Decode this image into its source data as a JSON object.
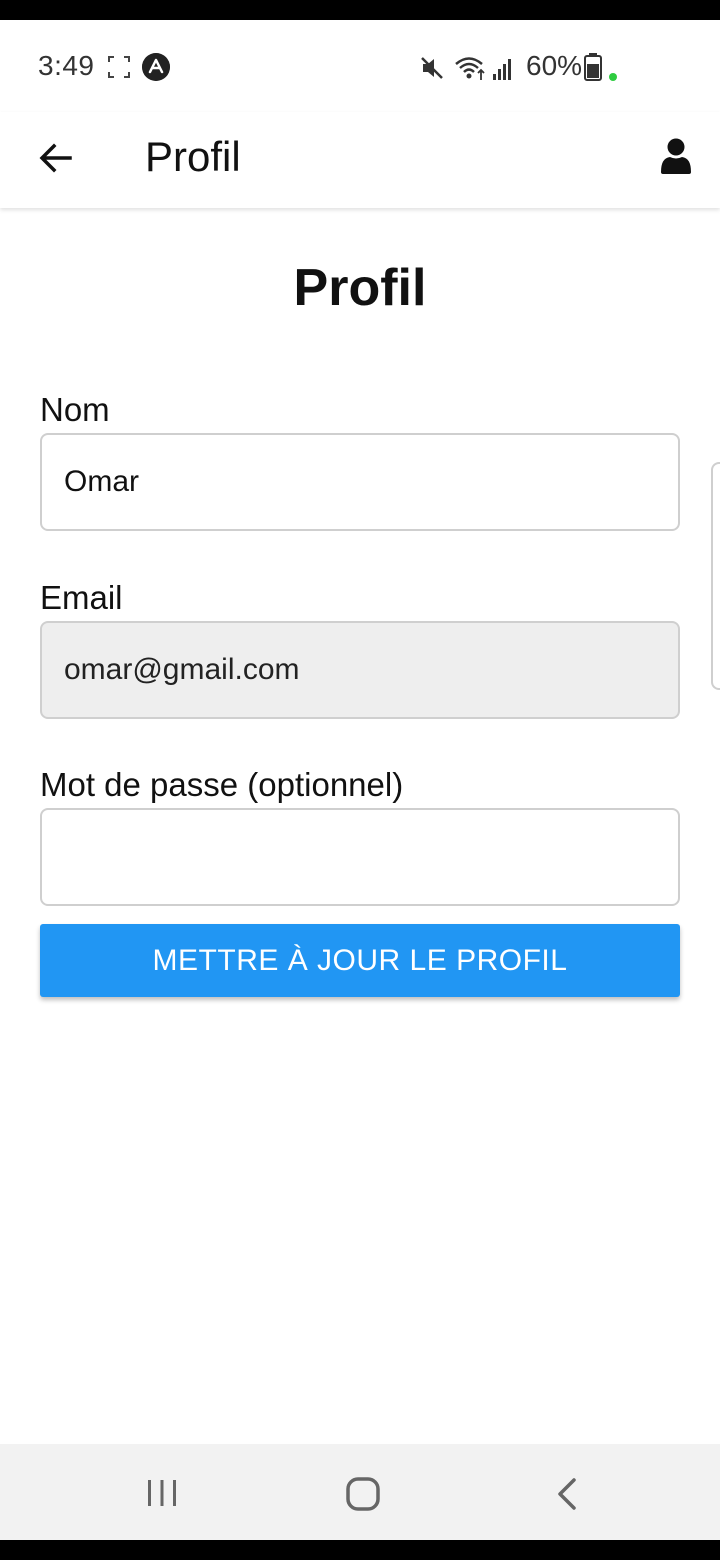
{
  "status_bar": {
    "time": "3:49",
    "battery": "60%",
    "icons": [
      "screenshot-icon",
      "app-notification-icon",
      "mute-icon",
      "wifi-icon",
      "signal-icon",
      "battery-icon"
    ]
  },
  "app_bar": {
    "title": "Profil",
    "back_icon": "arrow-left-icon",
    "user_icon": "user-icon"
  },
  "main": {
    "heading": "Profil",
    "fields": [
      {
        "label": "Nom",
        "value": "Omar",
        "placeholder": "",
        "disabled": false
      },
      {
        "label": "Email",
        "value": "omar@gmail.com",
        "placeholder": "",
        "disabled": true
      },
      {
        "label": "Mot de passe (optionnel)",
        "value": "",
        "placeholder": "",
        "disabled": false
      }
    ],
    "submit_label": "METTRE À JOUR LE PROFIL"
  },
  "colors": {
    "accent": "#2196f3",
    "disabled_field_bg": "#eeeeee",
    "field_border": "#cfcfcf"
  },
  "nav_bar": {
    "icons": [
      "recents-icon",
      "home-icon",
      "back-icon"
    ]
  }
}
